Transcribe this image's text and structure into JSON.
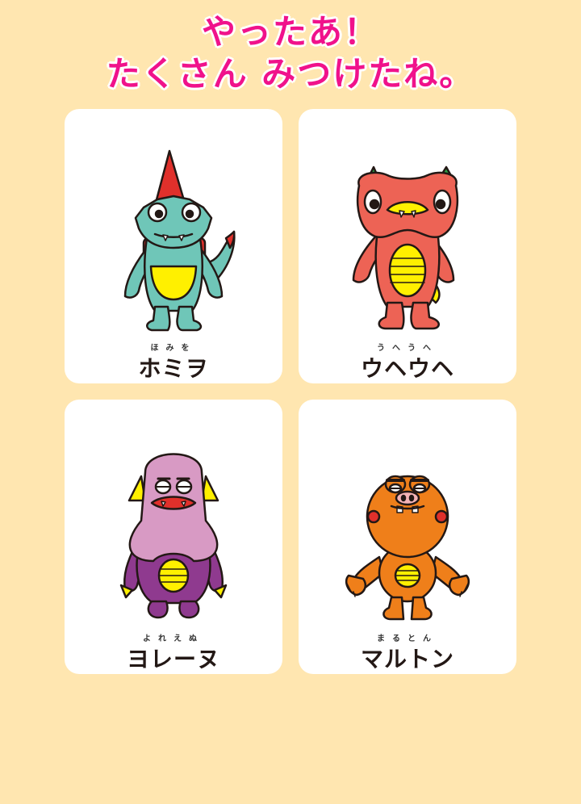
{
  "title": {
    "line1": "やったあ！",
    "line2": "たくさん みつけたね。"
  },
  "colors": {
    "background": "#ffe6b0",
    "title": "#f0128b",
    "card": "#ffffff"
  },
  "characters": [
    {
      "name": "ホミヲ",
      "ruby": "ほみを",
      "color": "#6fc6b8",
      "icon": "homiwo-monster-illustration"
    },
    {
      "name": "ウヘウヘ",
      "ruby": "うへうへ",
      "color": "#ed6355",
      "icon": "uheuhe-monster-illustration"
    },
    {
      "name": "ヨレーヌ",
      "ruby": "よれえぬ",
      "color": "#d89ac4",
      "icon": "yorenu-monster-illustration"
    },
    {
      "name": "マルトン",
      "ruby": "まるとん",
      "color": "#ef7f1a",
      "icon": "maruton-monster-illustration"
    }
  ]
}
